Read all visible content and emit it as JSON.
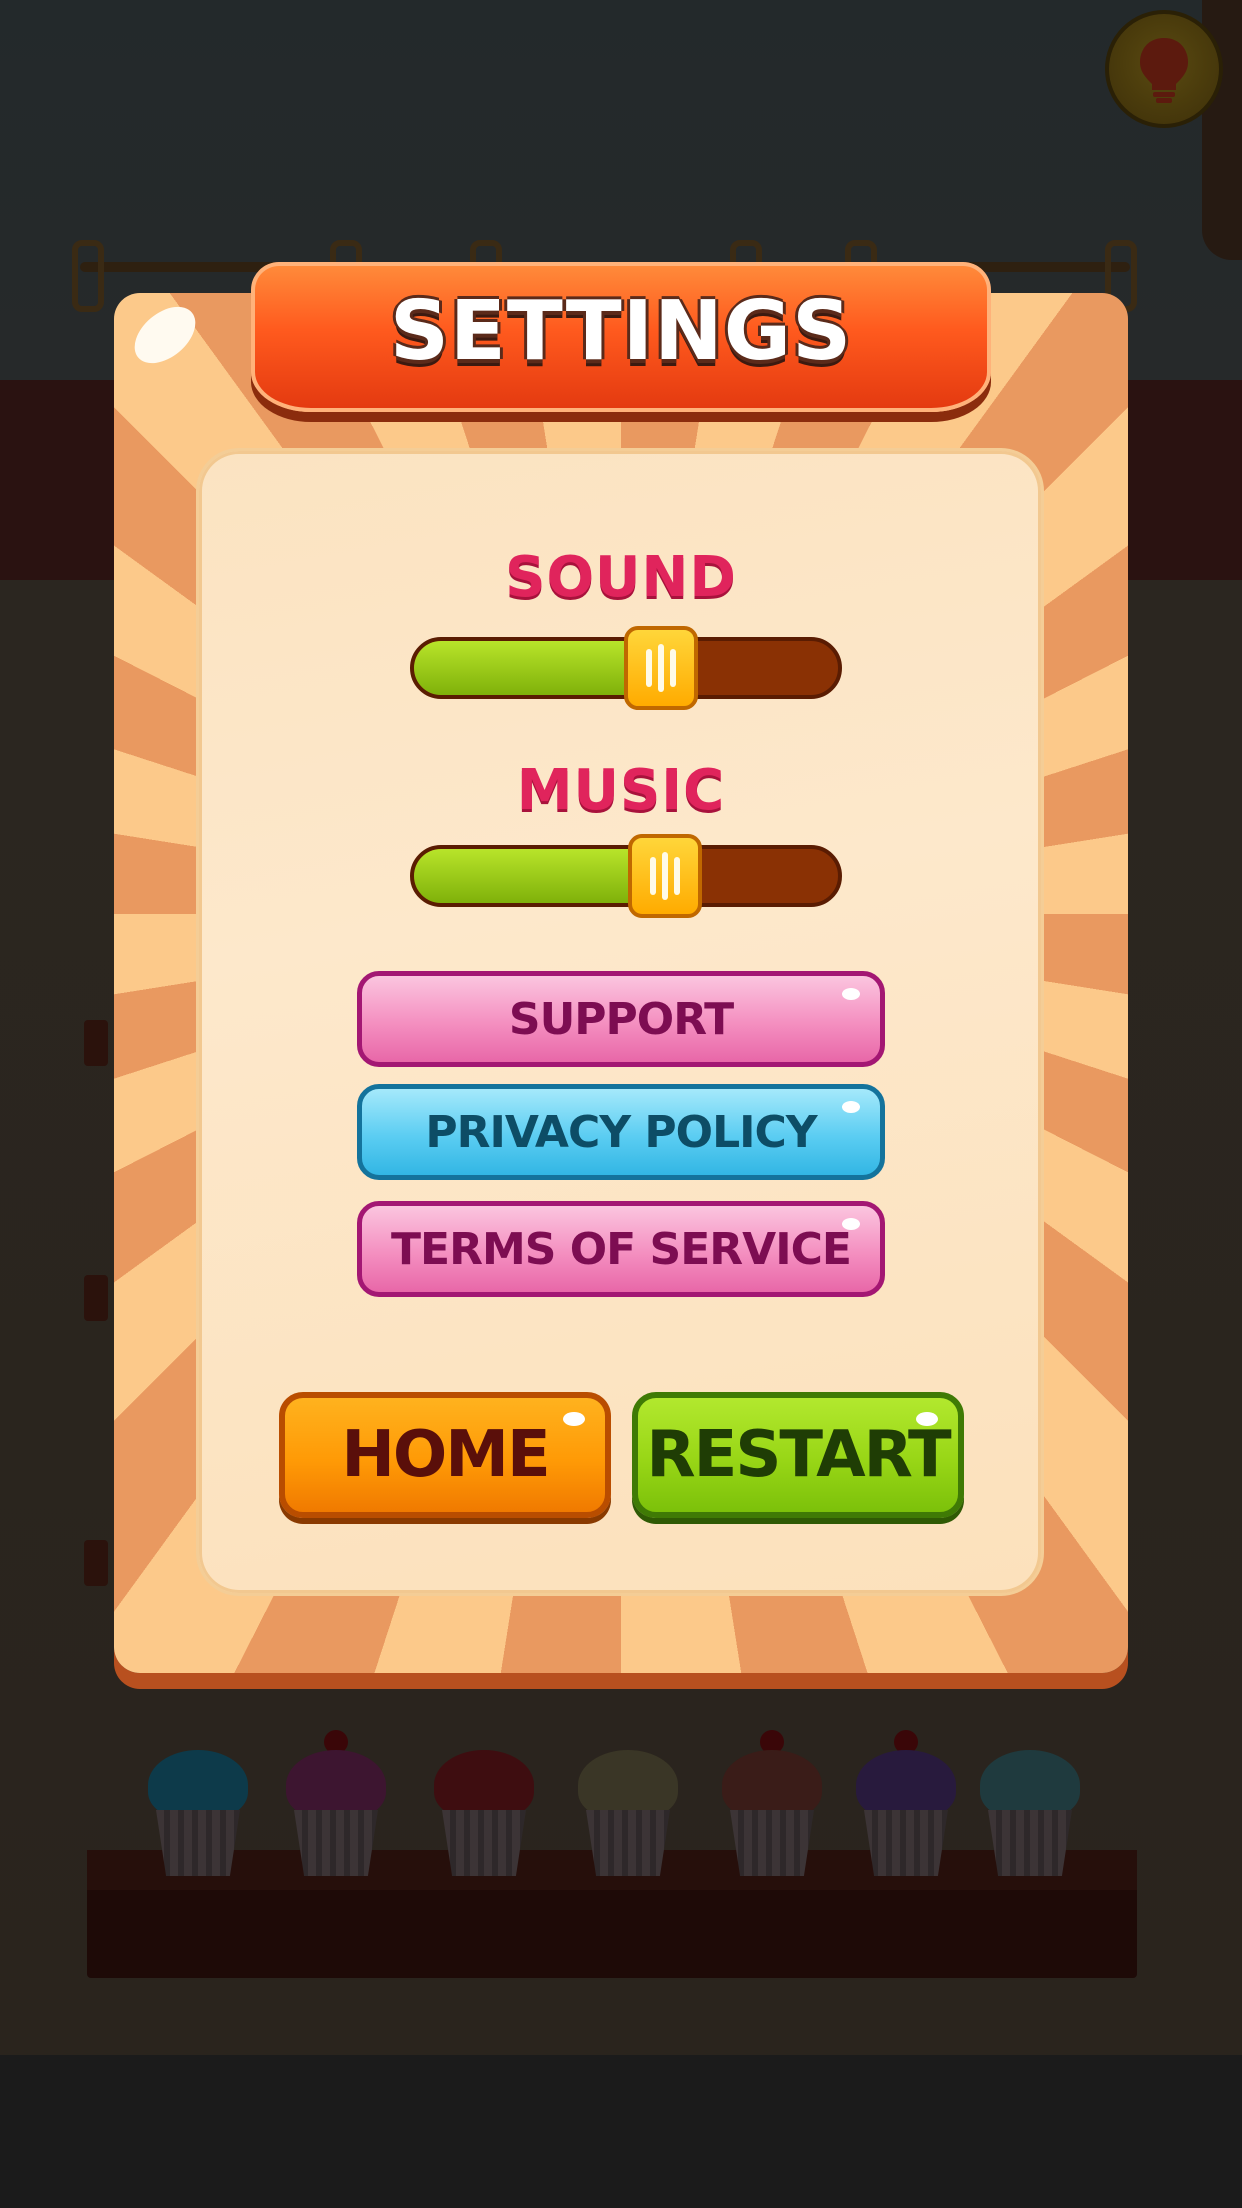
{
  "screen": {
    "title": "SETTINGS"
  },
  "sliders": [
    {
      "label": "SOUND",
      "value": 0.58
    },
    {
      "label": "MUSIC",
      "value": 0.59
    }
  ],
  "buttons": {
    "support": "SUPPORT",
    "privacy_policy": "PRIVACY POLICY",
    "terms_of_service": "TERMS OF SERVICE",
    "home": "HOME",
    "restart": "RESTART"
  },
  "icons": {
    "hint": "lightbulb-icon",
    "slider_knob": "slider-grip-icon"
  },
  "colors": {
    "title_banner": "#ff5a1e",
    "label_text": "#e0245c",
    "pink_button": "#f48fc0",
    "blue_button": "#5bcdf2",
    "home_button": "#ff9a06",
    "restart_button": "#98d616",
    "slider_fill": "#9ccc12",
    "slider_track": "#8a3104"
  }
}
